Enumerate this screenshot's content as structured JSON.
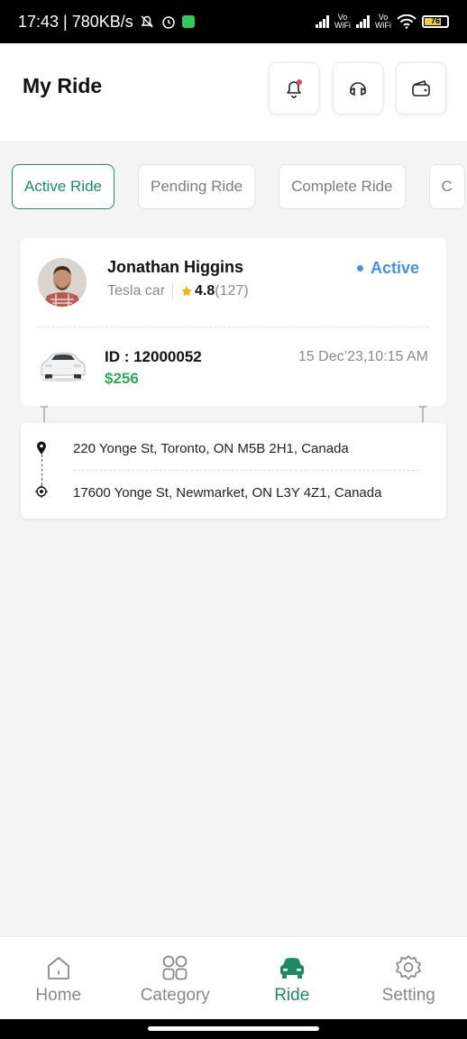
{
  "status_bar": {
    "time_speed": "17:43 | 780KB/s",
    "vo1": "Vo",
    "wifi1": "WiFi",
    "vo2": "Vo",
    "wifi2": "WiFi",
    "battery_pct": "76"
  },
  "header": {
    "title": "My Ride",
    "icons": [
      "bell-icon",
      "headset-icon",
      "wallet-icon"
    ]
  },
  "tabs": [
    {
      "label": "Active Ride"
    },
    {
      "label": "Pending Ride"
    },
    {
      "label": "Complete Ride"
    },
    {
      "label": "C"
    }
  ],
  "ride": {
    "driver_name": "Jonathan Higgins",
    "car": "Tesla car",
    "rating": "4.8",
    "reviews": "(127)",
    "status": "Active",
    "id": "ID : 12000052",
    "price": "$256",
    "date": "15 Dec’23,10:15 AM"
  },
  "route": {
    "pickup": "220 Yonge St, Toronto, ON M5B 2H1, Canada",
    "dropoff": "17600 Yonge St, Newmarket, ON L3Y 4Z1, Canada"
  },
  "nav": [
    {
      "label": "Home",
      "icon": "home-icon"
    },
    {
      "label": "Category",
      "icon": "grid-icon"
    },
    {
      "label": "Ride",
      "icon": "car-icon"
    },
    {
      "label": "Setting",
      "icon": "gear-icon"
    }
  ],
  "colors": {
    "accent": "#1d8a63",
    "active_status": "#4a90d9",
    "price": "#2eaa5a"
  }
}
